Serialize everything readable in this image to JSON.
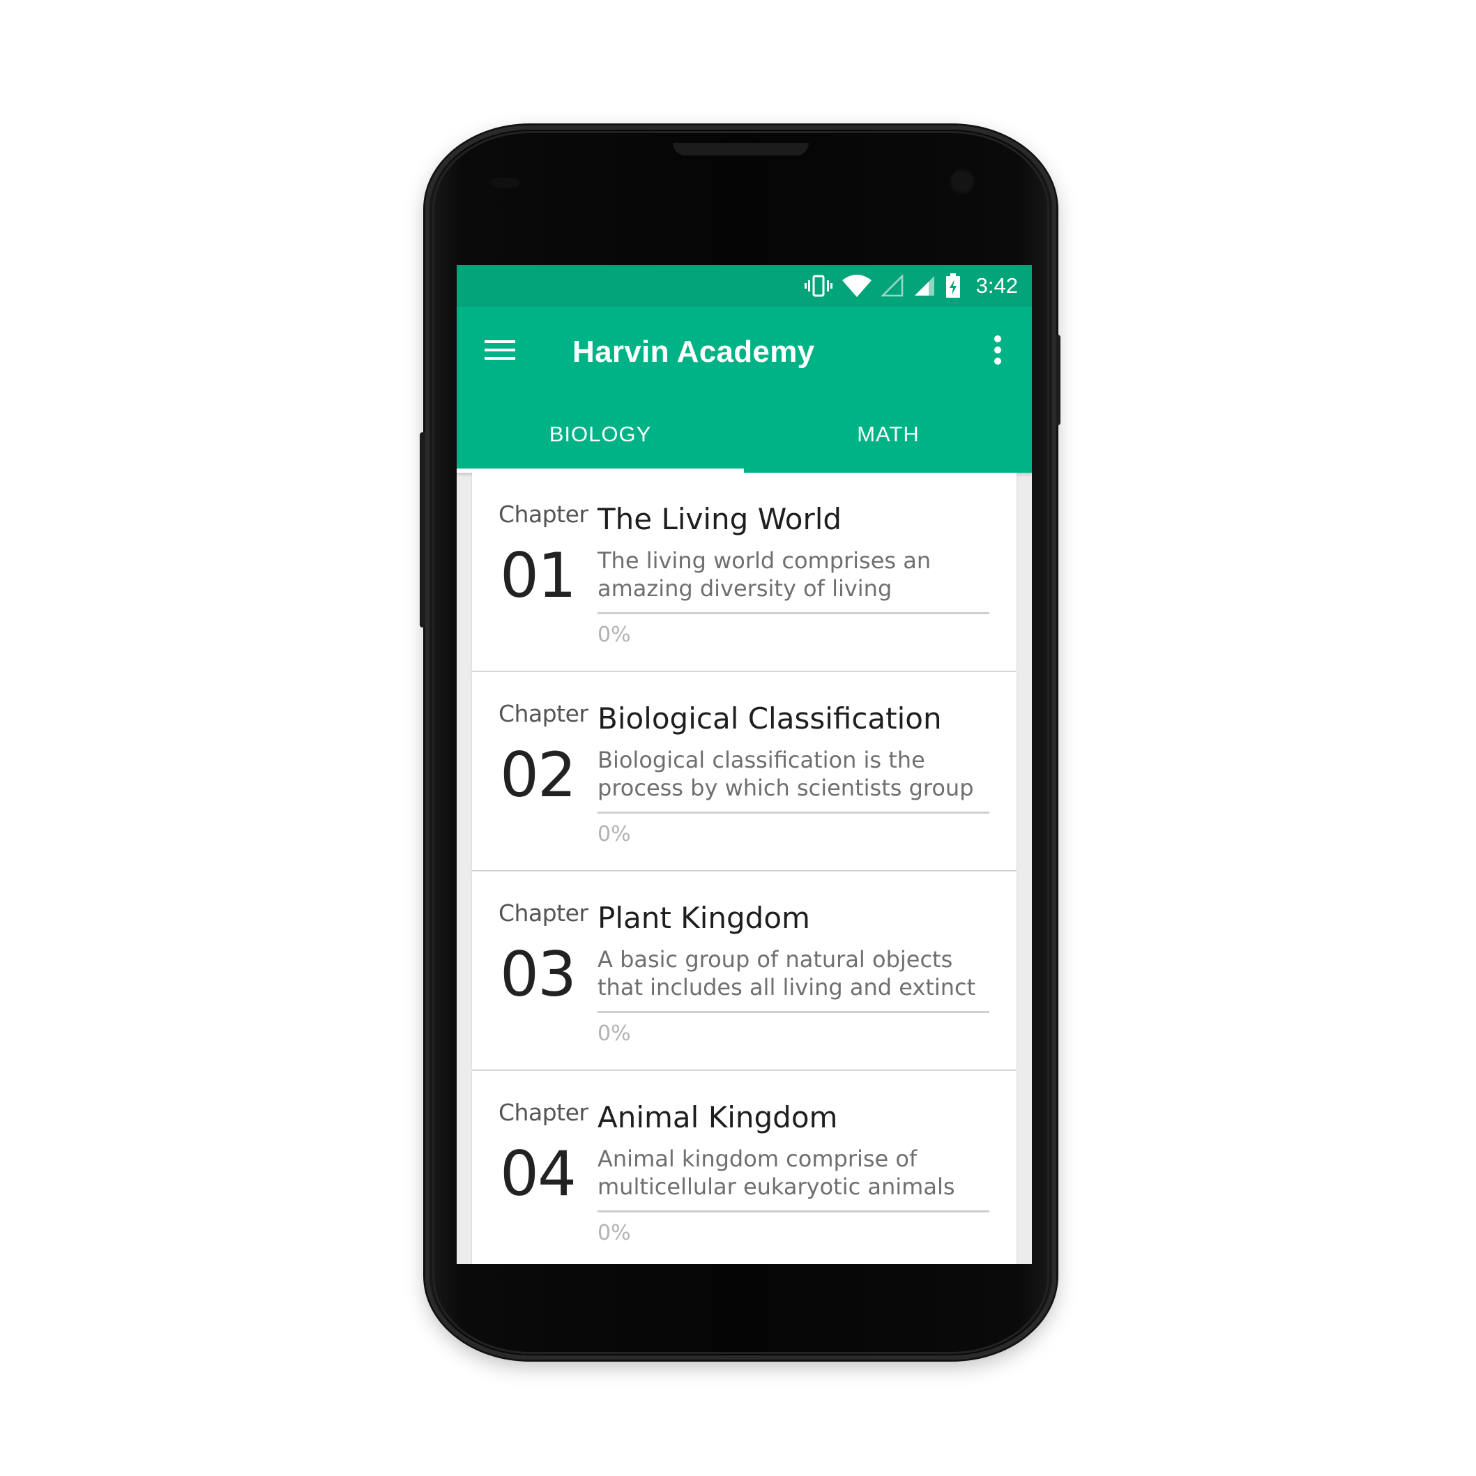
{
  "status_bar": {
    "time": "3:42",
    "icons": [
      "vibrate-icon",
      "wifi-icon",
      "signal-empty-icon",
      "signal-icon",
      "battery-charging-icon"
    ]
  },
  "app_bar": {
    "title": "Harvin Academy",
    "menu_icon": "hamburger-menu-icon",
    "overflow_icon": "more-vert-icon"
  },
  "tabs": [
    {
      "label": "BIOLOGY",
      "selected": true
    },
    {
      "label": "MATH",
      "selected": false
    }
  ],
  "chapters": [
    {
      "chapter_label": "Chapter",
      "number": "01",
      "title": "The Living World",
      "description": "The living world comprises an amazing diversity of living",
      "progress": 0,
      "progress_label": "0%"
    },
    {
      "chapter_label": "Chapter",
      "number": "02",
      "title": "Biological Classification",
      "description": "Biological classification is the process by which scientists group",
      "progress": 0,
      "progress_label": "0%"
    },
    {
      "chapter_label": "Chapter",
      "number": "03",
      "title": "Plant Kingdom",
      "description": "A basic group of natural objects that includes all living and extinct",
      "progress": 0,
      "progress_label": "0%"
    },
    {
      "chapter_label": "Chapter",
      "number": "04",
      "title": "Animal Kingdom",
      "description": "Animal kingdom comprise of multicellular eukaryotic animals",
      "progress": 0,
      "progress_label": "0%"
    }
  ],
  "colors": {
    "primary": "#00b386",
    "primary_dark": "#03a47a",
    "background": "#ececec"
  }
}
